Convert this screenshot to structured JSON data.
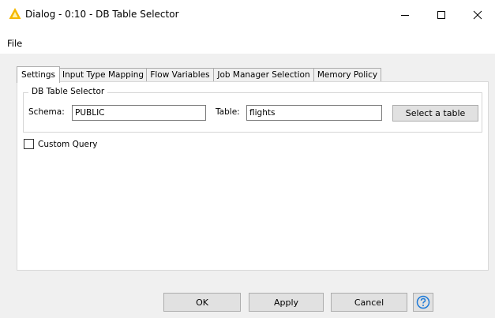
{
  "window": {
    "title": "Dialog - 0:10 - DB Table Selector",
    "icon": "warning-triangle-icon",
    "accent_color": "#f5b800"
  },
  "menu": {
    "file_label": "File"
  },
  "tabs": [
    {
      "label": "Settings",
      "active": true
    },
    {
      "label": "Input Type Mapping",
      "active": false
    },
    {
      "label": "Flow Variables",
      "active": false
    },
    {
      "label": "Job Manager Selection",
      "active": false
    },
    {
      "label": "Memory Policy",
      "active": false
    }
  ],
  "settings": {
    "group_title": "DB Table Selector",
    "schema_label": "Schema:",
    "schema_value": "PUBLIC",
    "table_label": "Table:",
    "table_value": "flights",
    "select_button": "Select a table",
    "custom_query_label": "Custom Query",
    "custom_query_checked": false
  },
  "buttons": {
    "ok": "OK",
    "apply": "Apply",
    "cancel": "Cancel",
    "help_icon": "help-question-icon",
    "help_color": "#1e7ad8"
  }
}
